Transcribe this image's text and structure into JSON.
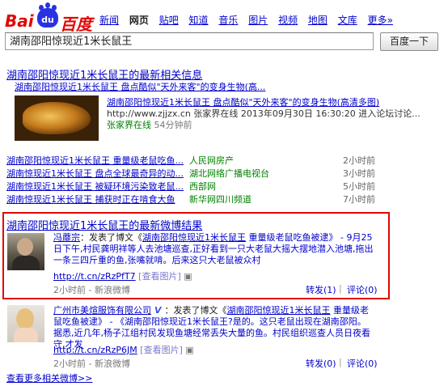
{
  "logo": {
    "left": "Bai",
    "paw": "du",
    "right": "百度"
  },
  "nav": [
    "新闻",
    "网页",
    "贴吧",
    "知道",
    "音乐",
    "图片",
    "视频",
    "地图",
    "文库",
    "更多»"
  ],
  "search": {
    "value": "湖南邵阳惊现近1米长鼠王",
    "button": "百度一下"
  },
  "latest": {
    "header": "湖南邵阳惊现近1米长鼠王的最新相关信息",
    "sub_title": "湖南邵阳惊现近1米长鼠王 盘点酷似\"天外来客\"的变身生物(高...",
    "item_title_red": "湖南邵阳惊现近1米长鼠王",
    "item_title_rest": " 盘点酷似\"天外来客\"的变身生物(高清多图)",
    "item_url": "http://www.zjjzx.cn 张家界在线 2013年09月30日 16:30:20 进入论坛讨论...",
    "item_source": "张家界在线",
    "item_time": "54分钟前"
  },
  "news": [
    {
      "red": "湖南邵阳惊现近1米长鼠王",
      "rest": " 重量级老鼠吃鱼...",
      "source": "人民网房产",
      "time": "2小时前"
    },
    {
      "red": "湖南惊现近1米长鼠王",
      "rest": " 盘点全球最奇异的动...",
      "source": "湖北网络广播电视台",
      "time": "3小时前"
    },
    {
      "red": "湖南惊现近1米长鼠王",
      "rest": " 被疑环境污染致老鼠...",
      "source": "西部网",
      "time": "5小时前"
    },
    {
      "red": "湖南惊现近1米长鼠王",
      "rest": " 捕获时正在啃食大鱼",
      "source": "新华网四川频道",
      "time": "7小时前"
    }
  ],
  "weibo": {
    "header": "湖南邵阳惊现近1米长鼠王的最新微博结果",
    "post1": {
      "user": "冯蘼宗",
      "text_a": "：发表了博文《",
      "red": "湖南邵阳惊现近1米长鼠王",
      "text_b": " 重量级老鼠吃鱼被逮》 - 9月25日下午,村民龚明祥等人去池塘巡查,正好看到一只大老鼠大摇大摆地潜入池塘,拖出一条三四斤重的鱼,张嘴就啃。后来这只大老鼠被众村",
      "link": "http://t.cn/zRzPfT7",
      "img": "[查看图片]",
      "meta": "2小时前 - 新浪微博",
      "repost": "转发(1)",
      "comment": "评论(0)"
    },
    "post2": {
      "user": "广州市美煊服饰有限公司",
      "verified": "V",
      "text_a": "：发表了博文《",
      "red": "湖南邵阳惊现近1米长鼠王",
      "text_b": " 重量级老鼠吃鱼被逮》 - 《湖南邵阳惊现近1米长鼠王?是的。这只老鼠出现在湖南邵阳。据悉,近几年,杨子江组村民发现鱼塘经常丢失大量的鱼。村民组织巡查人员日夜看守,才发",
      "link": "http://t.cn/zRzP6JM",
      "img": "[查看图片]",
      "meta": "2小时前 - 新浪微博",
      "repost": "转发(0)",
      "comment": "评论(0)"
    },
    "more": "查看更多相关微博>>"
  }
}
